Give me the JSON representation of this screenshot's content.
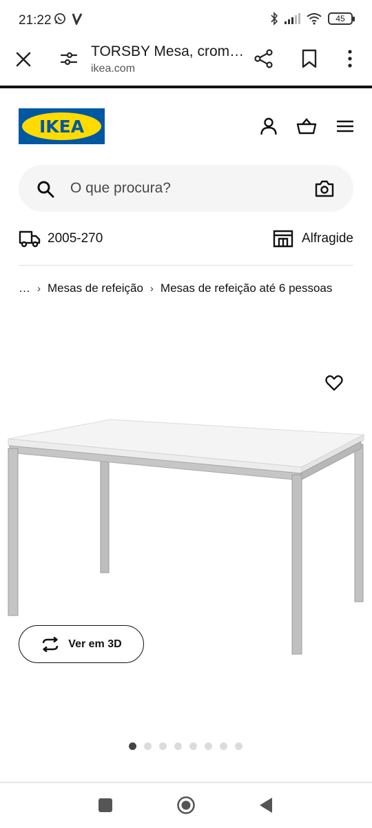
{
  "status": {
    "time": "21:22",
    "battery": "45",
    "icons": [
      "whatsapp-icon",
      "v-app-icon",
      "bluetooth-icon",
      "signal-icon",
      "wifi-icon",
      "battery-icon"
    ]
  },
  "browser": {
    "title": "TORSBY Mesa, crom…",
    "url": "ikea.com",
    "icons": [
      "close-icon",
      "tune-icon",
      "share-icon",
      "bookmark-icon",
      "more-icon"
    ]
  },
  "header": {
    "logo_text": "IKEA",
    "brand_colors": {
      "blue": "#0058a3",
      "yellow": "#ffdb00"
    },
    "icons": [
      "profile-icon",
      "basket-icon",
      "menu-icon"
    ]
  },
  "search": {
    "placeholder": "O que procura?"
  },
  "location": {
    "postcode": "2005-270",
    "store": "Alfragide"
  },
  "breadcrumb": {
    "items": [
      "…",
      "Mesas de refeição",
      "Mesas de refeição até 6 pessoas"
    ]
  },
  "product": {
    "view_3d_label": "Ver em 3D",
    "image_count": 8,
    "active_image": 1
  }
}
